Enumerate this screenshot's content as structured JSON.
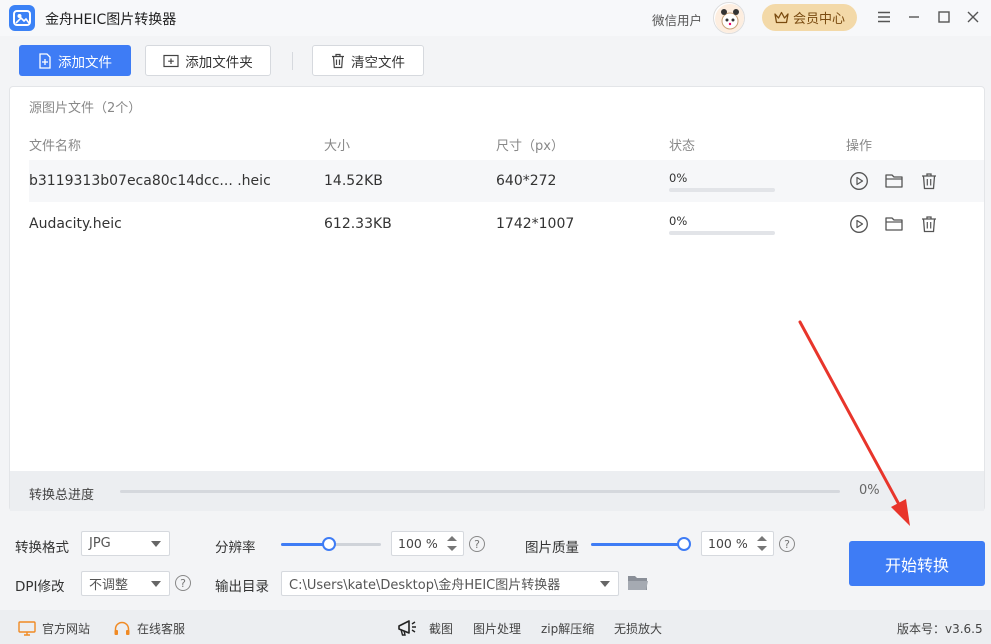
{
  "app": {
    "title": "金舟HEIC图片转换器",
    "user_label": "微信用户",
    "member_label": "会员中心"
  },
  "toolbar": {
    "add_file": "添加文件",
    "add_folder": "添加文件夹",
    "clear_files": "清空文件"
  },
  "file_panel": {
    "title": "源图片文件（2个）",
    "columns": [
      "文件名称",
      "大小",
      "尺寸（px）",
      "状态",
      "操作"
    ],
    "rows": [
      {
        "name": "b3119313b07eca80c14dcc... .heic",
        "size": "14.52KB",
        "dimensions": "640*272",
        "status": "0%",
        "progress": 0
      },
      {
        "name": "Audacity.heic",
        "size": "612.33KB",
        "dimensions": "1742*1007",
        "status": "0%",
        "progress": 0
      }
    ],
    "total_label": "转换总进度",
    "total_status": "0%",
    "total_progress": 0
  },
  "settings": {
    "format_label": "转换格式",
    "format_value": "JPG",
    "resolution_label": "分辨率",
    "resolution_value": "100 %",
    "resolution_level": 0.48,
    "quality_label": "图片质量",
    "quality_value": "100 %",
    "quality_level": 0.93,
    "dpi_label": "DPI修改",
    "dpi_value": "不调整",
    "output_label": "输出目录",
    "output_path": "C:\\Users\\kate\\Desktop\\金舟HEIC图片转换器",
    "help_glyph": "?"
  },
  "start_button": "开始转换",
  "footer": {
    "website": "官方网站",
    "support": "在线客服",
    "links": [
      "截图",
      "图片处理",
      "zip解压缩",
      "无损放大"
    ],
    "version": "版本号：v3.6.5"
  },
  "colors": {
    "accent": "#3e7cf5",
    "member_bg": "#f3d9a8",
    "arrow": "#e8352b"
  }
}
